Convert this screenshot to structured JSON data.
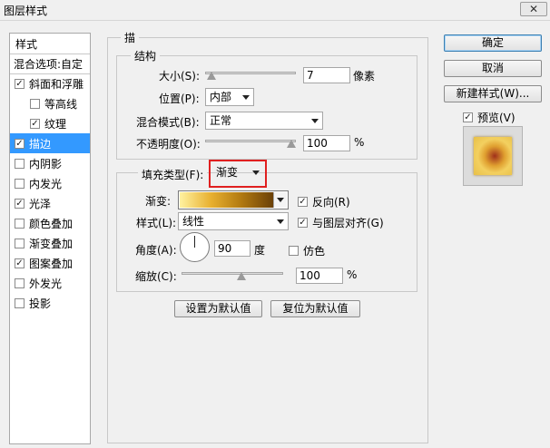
{
  "window": {
    "title": "图层样式",
    "close_glyph": "✕"
  },
  "left_panel": {
    "header": "样式",
    "blend_options": "混合选项:自定",
    "items": [
      {
        "label": "斜面和浮雕",
        "checked": true,
        "indent": false,
        "selected": false
      },
      {
        "label": "等高线",
        "checked": false,
        "indent": true,
        "selected": false
      },
      {
        "label": "纹理",
        "checked": true,
        "indent": true,
        "selected": false
      },
      {
        "label": "描边",
        "checked": true,
        "indent": false,
        "selected": true
      },
      {
        "label": "内阴影",
        "checked": false,
        "indent": false,
        "selected": false
      },
      {
        "label": "内发光",
        "checked": false,
        "indent": false,
        "selected": false
      },
      {
        "label": "光泽",
        "checked": true,
        "indent": false,
        "selected": false
      },
      {
        "label": "颜色叠加",
        "checked": false,
        "indent": false,
        "selected": false
      },
      {
        "label": "渐变叠加",
        "checked": false,
        "indent": false,
        "selected": false
      },
      {
        "label": "图案叠加",
        "checked": true,
        "indent": false,
        "selected": false
      },
      {
        "label": "外发光",
        "checked": false,
        "indent": false,
        "selected": false
      },
      {
        "label": "投影",
        "checked": false,
        "indent": false,
        "selected": false
      }
    ]
  },
  "stroke": {
    "title": "描",
    "structure": {
      "title": "结构",
      "size_label": "大小(S):",
      "size_value": "7",
      "size_unit": "像素",
      "size_fraction": 0.02,
      "position_label": "位置(P):",
      "position_value": "内部",
      "blend_label": "混合模式(B):",
      "blend_value": "正常",
      "opacity_label": "不透明度(O):",
      "opacity_value": "100",
      "opacity_unit": "%",
      "opacity_fraction": 1.0
    },
    "fill": {
      "type_label": "填充类型(F):",
      "type_value": "渐变",
      "gradient_label": "渐变:",
      "gradient_colors": [
        "#fff2a0",
        "#e8b030",
        "#b07810",
        "#6a4008"
      ],
      "reverse_label": "反向(R)",
      "reverse_checked": true,
      "style_label": "样式(L):",
      "style_value": "线性",
      "align_label": "与图层对齐(G)",
      "align_checked": true,
      "angle_label": "角度(A):",
      "angle_value": "90",
      "angle_unit": "度",
      "dither_label": "仿色",
      "dither_checked": false,
      "scale_label": "缩放(C):",
      "scale_value": "100",
      "scale_unit": "%",
      "scale_fraction": 0.6
    },
    "default_button": "设置为默认值",
    "reset_button": "复位为默认值"
  },
  "right": {
    "ok": "确定",
    "cancel": "取消",
    "new_style": "新建样式(W)...",
    "preview_label": "预览(V)",
    "preview_checked": true
  },
  "colors": {
    "highlight": "#3399ff",
    "callout": "#e02020"
  }
}
